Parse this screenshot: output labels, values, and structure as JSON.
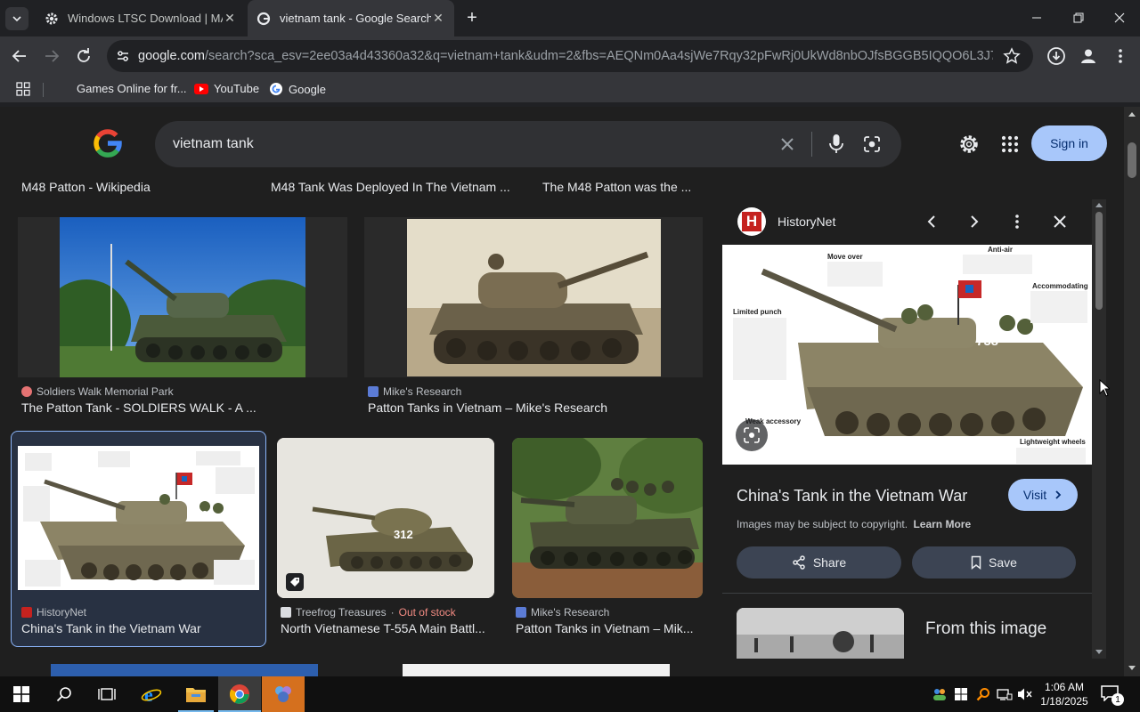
{
  "browser": {
    "tabs": [
      {
        "title": "Windows LTSC Download | MA"
      },
      {
        "title": "vietnam tank - Google Search"
      }
    ],
    "url_host": "google.com",
    "url_rest": "/search?sca_esv=2ee03a4d43360a32&q=vietnam+tank&udm=2&fbs=AEQNm0Aa4sjWe7Rqy32pFwRj0UkWd8nbOJfsBGGB5IQQO6L3J7pRxU...",
    "bookmarks": [
      {
        "label": "Games Online for fr..."
      },
      {
        "label": "YouTube"
      },
      {
        "label": "Google"
      }
    ]
  },
  "search": {
    "query": "vietnam tank",
    "sign_in": "Sign in"
  },
  "results": {
    "top_row": [
      "M48 Patton - Wikipedia",
      "M48 Tank Was Deployed In The Vietnam ...",
      "The M48 Patton was the ..."
    ],
    "row1": [
      {
        "source": "Soldiers Walk Memorial Park",
        "title": "The Patton Tank - SOLDIERS WALK - A ..."
      },
      {
        "source": "Mike's Research",
        "title": "Patton Tanks in Vietnam – Mike's Research"
      }
    ],
    "row2": [
      {
        "source": "HistoryNet",
        "title": "China's Tank in the Vietnam War"
      },
      {
        "source": "Treefrog Treasures",
        "stock": "Out of stock",
        "separator": "·",
        "title": "North Vietnamese T-55A Main Battl..."
      },
      {
        "source": "Mike's Research",
        "title": "Patton Tanks in Vietnam – Mik..."
      }
    ],
    "tank_number": "312"
  },
  "panel": {
    "source": "HistoryNet",
    "title": "China's Tank in the Vietnam War",
    "visit": "Visit",
    "copyright": "Images may be subject to copyright.",
    "learn_more": "Learn More",
    "share": "Share",
    "save": "Save",
    "from_image": "From this image",
    "infographic": {
      "anti_air": "Anti-air",
      "move_over": "Move over",
      "accommodating": "Accommodating",
      "limited_punch": "Limited punch",
      "weak_accessory": "Weak accessory",
      "lightweight_wheels": "Lightweight wheels",
      "tank_number": "758"
    }
  },
  "taskbar": {
    "time": "1:06 AM",
    "date": "1/18/2025",
    "notifications": "1"
  },
  "colors": {
    "accent_blue": "#a8c7fa",
    "out_of_stock": "#f28b82",
    "historynet_red": "#c5221f"
  }
}
